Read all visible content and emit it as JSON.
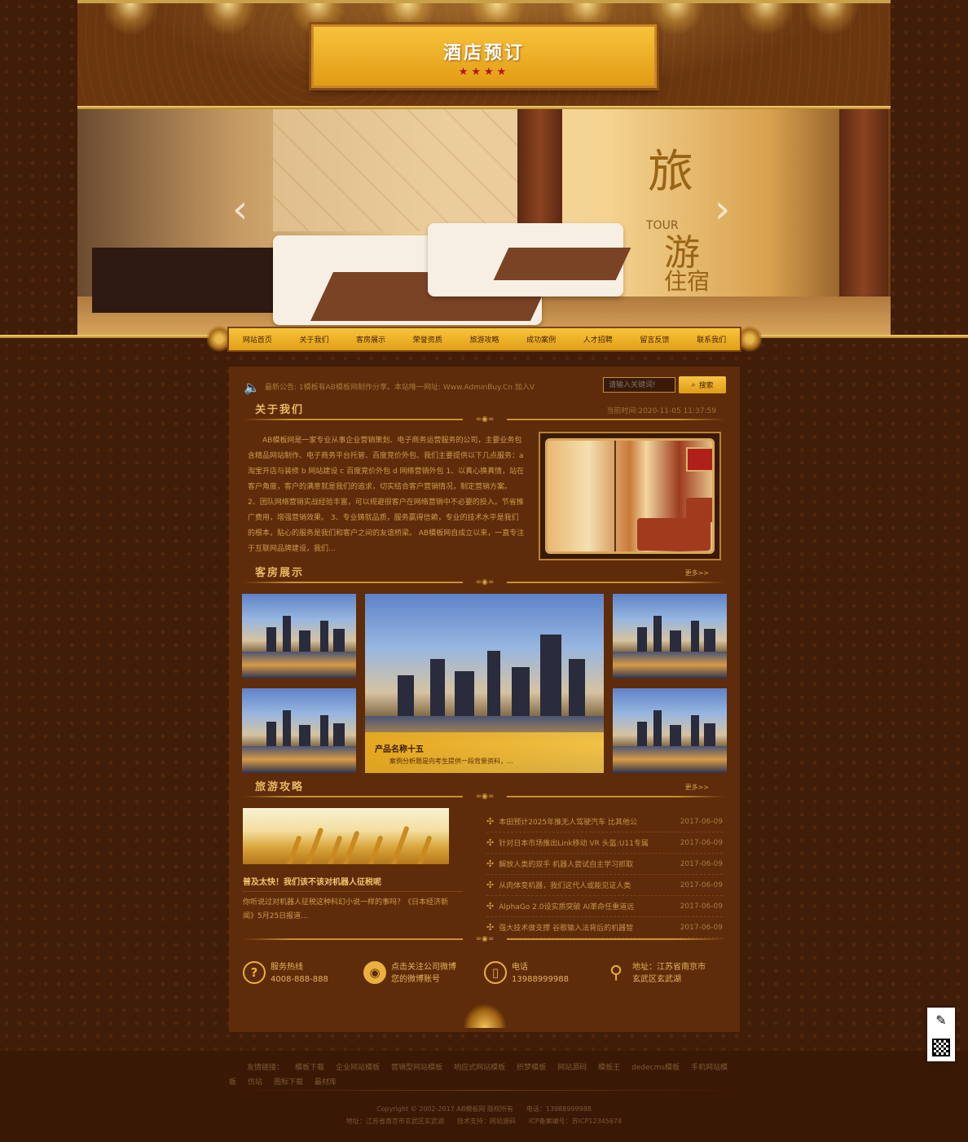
{
  "header": {
    "title": "酒店预订",
    "stars": "★★★★"
  },
  "banner": {
    "big1": "旅",
    "big2": "游",
    "big3": "住宿",
    "word": "TOUR",
    "prev": "‹",
    "next": "›"
  },
  "nav": [
    "网站首页",
    "关于我们",
    "客房展示",
    "荣誉资质",
    "旅游攻略",
    "成功案例",
    "人才招聘",
    "留言反馈",
    "联系我们"
  ],
  "notice": {
    "text": "最新公告: 1模板有AB模板网制作分享。本站唯一网址: Www.AdminBuy.Cn 加入V"
  },
  "search": {
    "placeholder": "请输入关键词!",
    "button": "搜索"
  },
  "about": {
    "title": "关于我们",
    "date": "当前时间:2020-11-05 11:37:59",
    "text": "AB模板网是一家专业从事企业营销策划、电子商务运营服务的公司，主要业务包含精品网站制作、电子商务平台托管、百度竞价外包、我们主要提供以下几点服务：a 淘宝开店与装修 b 网站建设 c 百度竞价外包 d 网络营销外包 1、以真心换真情，站在客户角度，客户的满意就是我们的追求，切实结合客户营销情况，制定营销方案。 2、团队网络营销实战经验丰富，可以规避很客户在网络营销中不必要的投入。节省推广费用，增强营销效果。 3、专业铸就品质，服务赢得信赖，专业的技术水平是我们的根本，贴心的服务是我们和客户之间的友谊桥梁。 AB模板网自成立以来，一直专注于互联网品牌建设，我们..."
  },
  "rooms": {
    "title": "客房展示",
    "more": "更多>>",
    "featured_name": "产品名称十五",
    "featured_desc": "案例分析题是向考生提供一段背景资料，..."
  },
  "guide": {
    "title": "旅游攻略",
    "more": "更多>>",
    "headline": "普及太快！我们该不该对机器人征税呢",
    "summary": "你听说过对机器人征税这种科幻小说一样的事吗？《日本经济新闻》5月25日报道...",
    "items": [
      {
        "t": "本田预计2025年推无人驾驶汽车 比其他公",
        "d": "2017-06-09"
      },
      {
        "t": "针对日本市场推出Link移动 VR 头盔:U11专属",
        "d": "2017-06-09"
      },
      {
        "t": "解放人类的双手 机器人尝试自主学习抓取",
        "d": "2017-06-09"
      },
      {
        "t": "从肉体变机器，我们这代人或能见证人类",
        "d": "2017-06-09"
      },
      {
        "t": "AlphaGo 2.0设实质突破 AI革命任重道远",
        "d": "2017-06-09"
      },
      {
        "t": "强大技术做支撑 谷歌输入法背后的机器智",
        "d": "2017-06-09"
      }
    ]
  },
  "contact": [
    {
      "icon": "?",
      "l1": "服务热线",
      "l2": "4008-888-888"
    },
    {
      "icon": "◉",
      "l1": "点击关注公司微博",
      "l2": "您的微博账号"
    },
    {
      "icon": "▯",
      "l1": "电话",
      "l2": "13988999988"
    },
    {
      "icon": "⚲",
      "l1": "地址：江苏省南京市",
      "l2": "玄武区玄武湖"
    }
  ],
  "footer": {
    "links_label": "友情链接：",
    "links": [
      "模板下载",
      "企业网站模板",
      "营销型网站模板",
      "响应式网站模板",
      "织梦模板",
      "网站源码",
      "模板王",
      "dedecms模板",
      "手机网站模板",
      "仿站",
      "图标下载",
      "最材库"
    ],
    "copy1": "Copyright © 2002-2017 AB模板网 版权所有　　电话：13988999988",
    "copy2": "地址：江苏省南京市玄武区玄武湖　　技术支持：网站源码　　ICP备案编号：苏ICP12345678"
  },
  "colors": {
    "gold": "#e9b040",
    "bg": "#3a1b07",
    "panel": "#5e2c0a"
  }
}
